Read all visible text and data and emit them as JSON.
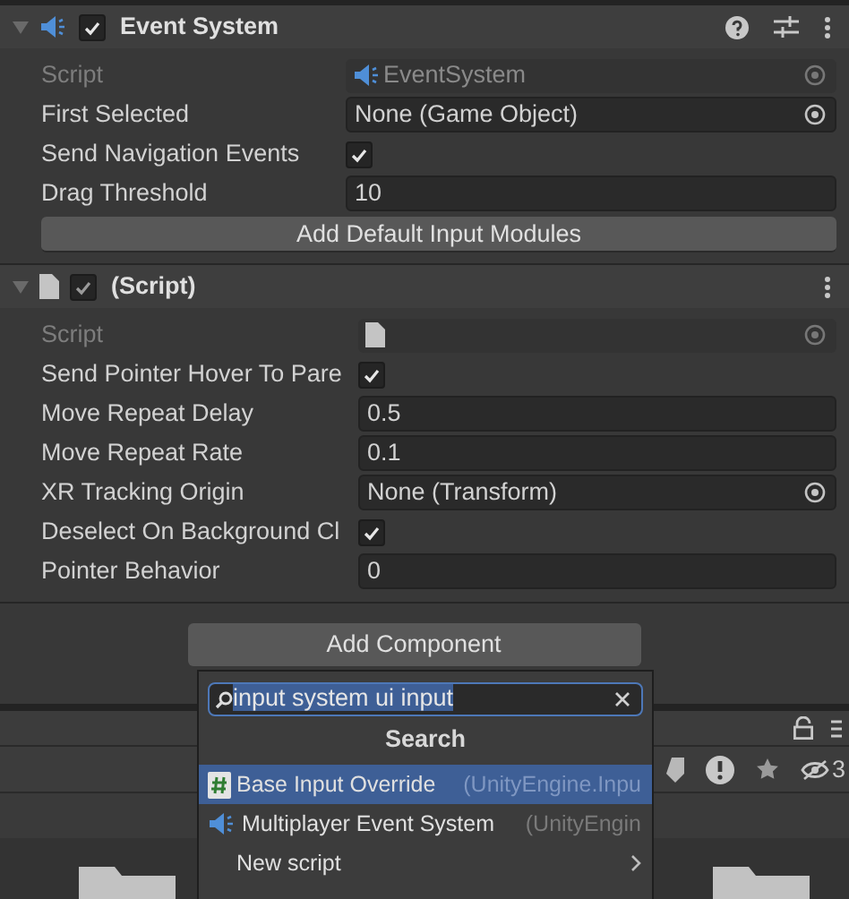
{
  "components": [
    {
      "title": "Event System",
      "enabled": true,
      "expanded": true,
      "fields": [
        {
          "kind": "script",
          "label": "Script",
          "value": "EventSystem"
        },
        {
          "kind": "object",
          "label": "First Selected",
          "value": "None (Game Object)"
        },
        {
          "kind": "toggle",
          "label": "Send Navigation Events",
          "checked": true
        },
        {
          "kind": "text",
          "label": "Drag Threshold",
          "value": "10"
        }
      ],
      "button": "Add Default Input Modules"
    },
    {
      "title": "(Script)",
      "enabled": true,
      "expanded": true,
      "fields": [
        {
          "kind": "script",
          "label": "Script"
        },
        {
          "kind": "toggle",
          "label": "Send Pointer Hover To Pare",
          "checked": true
        },
        {
          "kind": "text",
          "label": "Move Repeat Delay",
          "value": "0.5"
        },
        {
          "kind": "text",
          "label": "Move Repeat Rate",
          "value": "0.1"
        },
        {
          "kind": "object",
          "label": "XR Tracking Origin",
          "value": "None (Transform)"
        },
        {
          "kind": "toggle",
          "label": "Deselect On Background Cl",
          "checked": true
        },
        {
          "kind": "text",
          "label": "Pointer Behavior",
          "value": "0"
        }
      ]
    }
  ],
  "add_component": "Add Component",
  "popup": {
    "search": {
      "value": "input system ui input"
    },
    "header": "Search",
    "items": [
      {
        "kind": "script",
        "name": "Base Input Override",
        "namespace": "(UnityEngine.Inpu",
        "selected": true
      },
      {
        "kind": "component",
        "name": "Multiplayer Event System",
        "namespace": "(UnityEngin",
        "selected": false
      },
      {
        "kind": "submenu",
        "name": "New script",
        "selected": false
      }
    ]
  },
  "project_toolbar": {
    "hidden_count": "3"
  }
}
